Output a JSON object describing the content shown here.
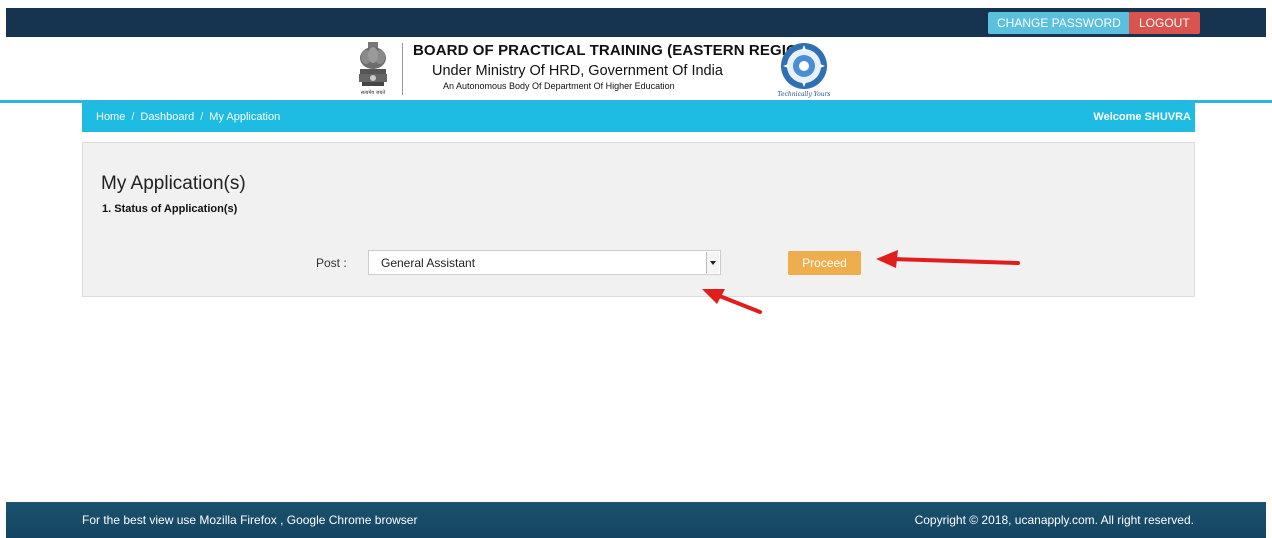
{
  "topbar": {
    "change_password_label": "CHANGE PASSWORD",
    "logout_label": "LOGOUT"
  },
  "header": {
    "title": "BOARD OF PRACTICAL TRAINING (EASTERN REGION)",
    "subtitle": "Under Ministry Of HRD, Government Of India",
    "tagline": "An Autonomous Body Of Department Of Higher Education",
    "emblem_caption": "सत्यमेव जयते",
    "seal_caption": "Technically Yours"
  },
  "breadcrumb": {
    "items": [
      "Home",
      "Dashboard",
      "My Application"
    ],
    "separator": "/",
    "welcome": "Welcome SHUVRA"
  },
  "main": {
    "title": "My Application(s)",
    "section": "1. Status of Application(s)",
    "post_label": "Post :",
    "post_selected": "General Assistant",
    "proceed_label": "Proceed"
  },
  "footer": {
    "left": "For the best view use Mozilla Firefox , Google Chrome browser",
    "right": "Copyright © 2018, ucanapply.com. All right reserved."
  },
  "colors": {
    "topbar": "#16344f",
    "accent": "#1ebbe2",
    "change_password": "#5bc0de",
    "logout": "#d9534f",
    "proceed": "#f0ad4e",
    "annotation_arrow": "#e01e1e"
  },
  "icons": [
    "national-emblem-icon",
    "bopt-seal-icon",
    "dropdown-arrow-icon",
    "annotation-arrow-icon"
  ]
}
